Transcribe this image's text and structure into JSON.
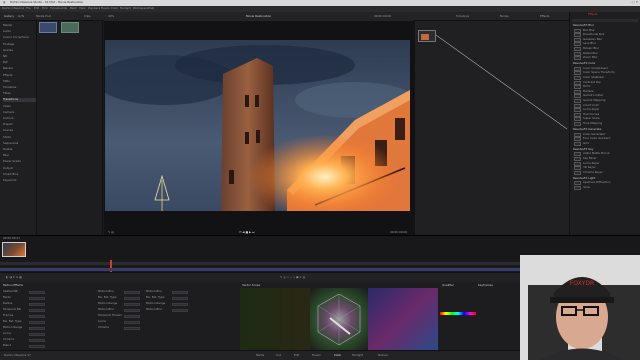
{
  "titlebar": {
    "title": "DaVinci Resolve Studio - 01 Mod - Movie Restoration"
  },
  "menu": [
    "DaVinci Resolve",
    "File",
    "Edit",
    "Trim",
    "Timeline",
    "Clip",
    "Mark",
    "View",
    "Playback",
    "Fusion",
    "Color",
    "Fairlight",
    "Workspace",
    "Help"
  ],
  "toolbar": {
    "project": "01 MOD - Movie Restoration",
    "tabs": [
      "Gallery",
      "LUTs",
      "Media Pool",
      "Clips",
      "Timelines",
      "Nodes",
      "Effects",
      "Lightbox"
    ]
  },
  "viewer": {
    "clip_name": "Movie Restoration",
    "zoom": "40%",
    "timecode": "00:00:00:00"
  },
  "left_panel": {
    "items": [
      "Master",
      "Audio",
      "Colour Corrections",
      "Footage",
      "Grades",
      "ND",
      "Ref",
      "Render",
      "Effects",
      "Stills",
      "Timelines",
      "Titles",
      "Transitions",
      "Video",
      "Camera",
      "Archive",
      "Project",
      "Scenes",
      "Shots",
      "Sequences",
      "Dailies",
      "Misc",
      "Power Grade",
      "Output",
      "Smart Bins",
      "Keywords"
    ]
  },
  "effects_panel": {
    "title": "ResolveFX Blur",
    "sections": [
      {
        "name": "ResolveFX Blur",
        "items": [
          "Box Blur",
          "Directional Blur",
          "Gaussian Blur",
          "Lens Blur",
          "Mosaic Blur",
          "Radial Blur",
          "Zoom Blur"
        ]
      },
      {
        "name": "ResolveFX Color",
        "items": [
          "Color Compressor",
          "Color Space Transform",
          "Color Stabilizer",
          "Contrast Pop",
          "DCTL",
          "Dehaze",
          "Gamut Limiter",
          "Gamut Mapping",
          "Invert Color",
          "Luma Keyer",
          "Hue Curves",
          "Super Scale",
          "Tone Mapping"
        ]
      },
      {
        "name": "ResolveFX Generate",
        "items": [
          "Color Generator",
          "Four Color Gradient",
          "Grid"
        ]
      },
      {
        "name": "ResolveFX Key",
        "items": [
          "Alpha Matte Shrink",
          "Key Mixer",
          "Luma Keyer",
          "3D Keyer",
          "Chroma Keyer"
        ]
      },
      {
        "name": "ResolveFX Light",
        "items": [
          "Aperture Diffraction",
          "Glow"
        ]
      }
    ]
  },
  "timeline": {
    "clip_label": "00:00:00:01",
    "clip_number": "01"
  },
  "bottom": {
    "left_title": "Motion Effects",
    "left_labels": [
      "Spatial NR",
      "Mode",
      "Radius",
      "Temporal NR",
      "Frames",
      "Mo. Est. Type",
      "Motion Range",
      "Luma",
      "Chroma",
      "Blend"
    ],
    "mid_labels": [
      "Motion Blur",
      "Mo. Est. Type",
      "Motion Range",
      "Motion Blur",
      "Temporal Threshold",
      "Luma",
      "Chroma"
    ],
    "mid2_labels": [
      "Motion Blur",
      "Mo. Est. Type",
      "Motion Range",
      "Motion Blur"
    ],
    "scope_title": "Vector Scope",
    "keyer_title": "Qualifier",
    "right_title": "Keyframes"
  },
  "pagebar": {
    "app": "DaVinci Resolve 17",
    "pages": [
      "Media",
      "Cut",
      "Edit",
      "Fusion",
      "Color",
      "Fairlight",
      "Deliver"
    ],
    "active": "Color"
  },
  "webcam": {
    "cap_text": "FOXYDR"
  },
  "colors": {
    "accent": "#e04a2a",
    "active_page": "#e8e8ec",
    "playhead": "#d23a2a"
  }
}
